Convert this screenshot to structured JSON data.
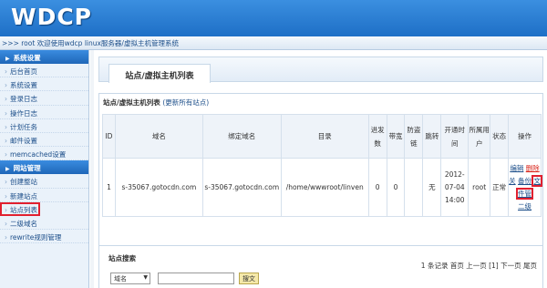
{
  "header": {
    "logo": "WDCP"
  },
  "welcome": ">>> root 欢迎使用wdcp linux服务器/虚拟主机管理系统",
  "sidebar": {
    "sections": [
      {
        "title": "系统设置",
        "items": [
          "后台首页",
          "系统设置",
          "登录日志",
          "操作日志",
          "计划任务",
          "邮件设置",
          "memcached设置"
        ]
      },
      {
        "title": "网站管理",
        "items": [
          "创建整站",
          "新建站点",
          "站点列表",
          "二级域名",
          "rewrite规则管理"
        ]
      }
    ]
  },
  "page": {
    "title": "站点/虚拟主机列表"
  },
  "list": {
    "title": "站点/虚拟主机列表",
    "refresh_link": "(更新所有站点)",
    "columns": [
      "ID",
      "域名",
      "绑定域名",
      "目录",
      "进发数",
      "带宽",
      "防盗链",
      "跳转",
      "开通时间",
      "所属用户",
      "状态",
      "操作"
    ],
    "rows": [
      {
        "id": "1",
        "domain": "s-35067.gotocdn.com",
        "bind_domain": "s-35067.gotocdn.com",
        "dir": "/home/wwwroot/linven",
        "conns": "0",
        "bandwidth": "0",
        "hotlink": "",
        "redirect": "无",
        "created": "2012-07-04 14:00",
        "user": "root",
        "status": "正常",
        "ops": {
          "edit": "编辑",
          "delete": "删除",
          "close": "关",
          "backup": "备份",
          "file": "文件管",
          "subdomain": "二级"
        }
      }
    ]
  },
  "pager": "1 条记录 首页 上一页 [1] 下一页 尾页",
  "search": {
    "title": "站点搜索",
    "field": "域名",
    "button": "搜文"
  },
  "colors": {
    "header": "#2a7dd4",
    "highlight": "#e1202f"
  }
}
